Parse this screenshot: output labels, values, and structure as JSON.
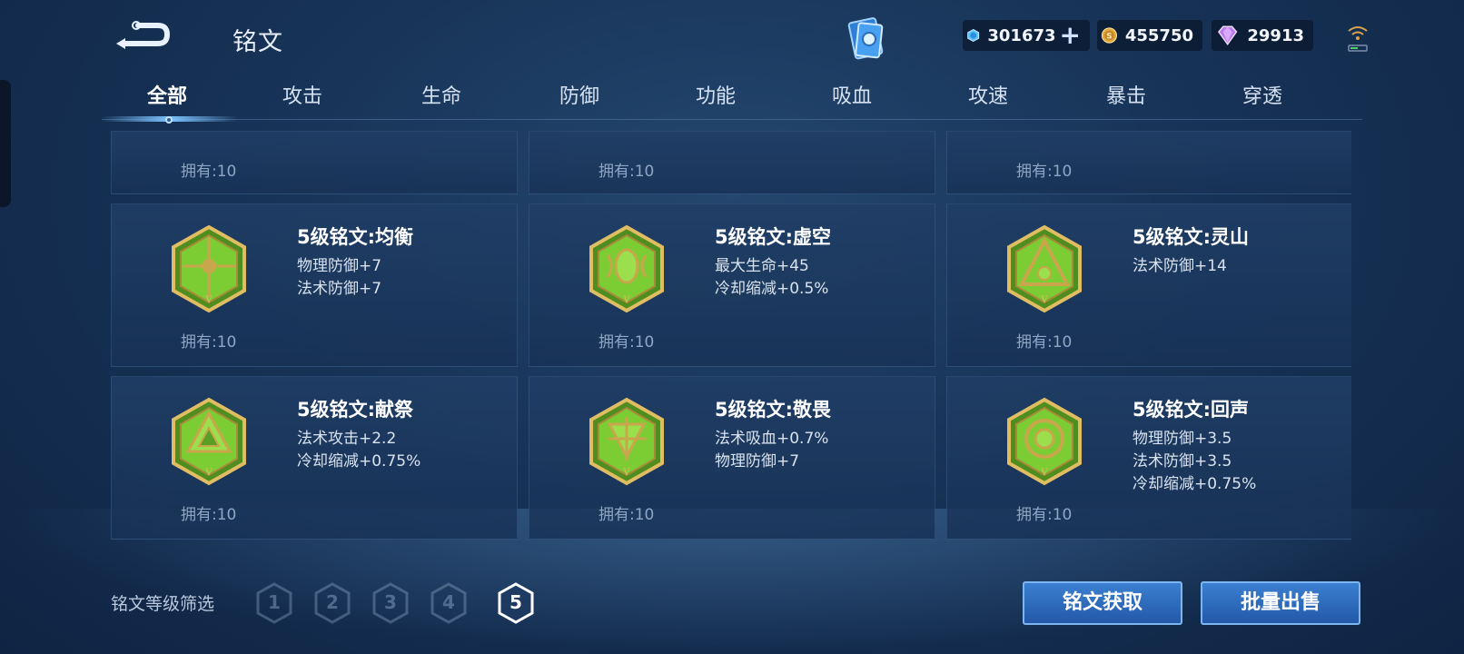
{
  "header": {
    "title": "铭文",
    "currencies": [
      {
        "icon": "coupon-crystal-icon",
        "value": "301673",
        "has_plus": true
      },
      {
        "icon": "gold-coin-icon",
        "value": "455750",
        "has_plus": false
      },
      {
        "icon": "diamond-gem-icon",
        "value": "29913",
        "has_plus": false
      }
    ],
    "plus_label": "+"
  },
  "tabs": [
    {
      "label": "全部",
      "active": true
    },
    {
      "label": "攻击",
      "active": false
    },
    {
      "label": "生命",
      "active": false
    },
    {
      "label": "防御",
      "active": false
    },
    {
      "label": "功能",
      "active": false
    },
    {
      "label": "吸血",
      "active": false
    },
    {
      "label": "攻速",
      "active": false
    },
    {
      "label": "暴击",
      "active": false
    },
    {
      "label": "穿透",
      "active": false
    }
  ],
  "top_row_owned": [
    "拥有:10",
    "拥有:10",
    "拥有:10"
  ],
  "runes": [
    {
      "name": "5级铭文:均衡",
      "attrs": [
        "物理防御+7",
        "法术防御+7"
      ],
      "owned": "拥有:10",
      "emblem": "balance-rune-icon"
    },
    {
      "name": "5级铭文:虚空",
      "attrs": [
        "最大生命+45",
        "冷却缩减+0.5%"
      ],
      "owned": "拥有:10",
      "emblem": "void-rune-icon"
    },
    {
      "name": "5级铭文:灵山",
      "attrs": [
        "法术防御+14"
      ],
      "owned": "拥有:10",
      "emblem": "spirit-mountain-rune-icon"
    },
    {
      "name": "5级铭文:献祭",
      "attrs": [
        "法术攻击+2.2",
        "冷却缩减+0.75%"
      ],
      "owned": "拥有:10",
      "emblem": "sacrifice-rune-icon"
    },
    {
      "name": "5级铭文:敬畏",
      "attrs": [
        "法术吸血+0.7%",
        "物理防御+7"
      ],
      "owned": "拥有:10",
      "emblem": "awe-rune-icon"
    },
    {
      "name": "5级铭文:回声",
      "attrs": [
        "物理防御+3.5",
        "法术防御+3.5",
        "冷却缩减+0.75%"
      ],
      "owned": "拥有:10",
      "emblem": "echo-rune-icon"
    }
  ],
  "footer": {
    "filter_label": "铭文等级筛选",
    "levels": [
      "1",
      "2",
      "3",
      "4",
      "5"
    ],
    "active_level": "5",
    "obtain_label": "铭文获取",
    "sell_label": "批量出售"
  },
  "colors": {
    "accent_blue": "#3b7fd0",
    "rune_green": "#6fbf2a",
    "rune_gold": "#d9b45a"
  }
}
